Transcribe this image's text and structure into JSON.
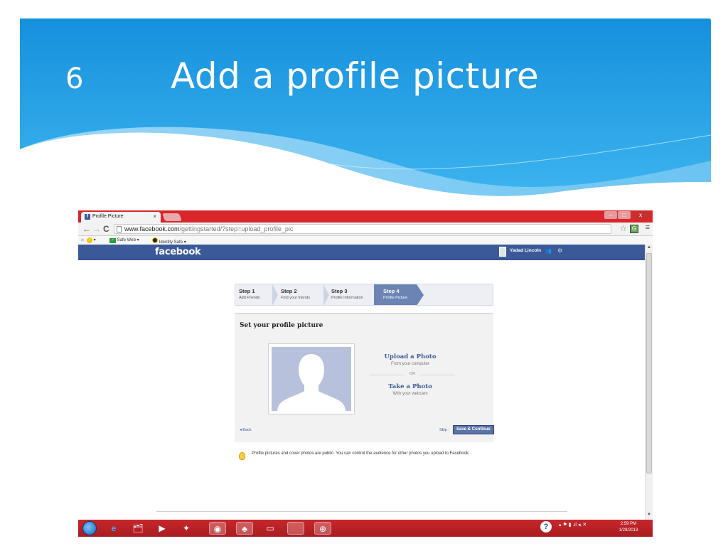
{
  "slide": {
    "number": "6",
    "title": "Add a profile picture"
  },
  "browser": {
    "tab_title": "Profile Picture",
    "tab_close": "×",
    "url_domain": "www.facebook.com",
    "url_path": "/gettingstarted/?step=upload_profile_pic",
    "back": "←",
    "forward": "→",
    "reload": "C",
    "star": "☆",
    "menu": "≡",
    "window_minimize": "–",
    "window_maximize": "□",
    "window_close": "x"
  },
  "toolbar": {
    "close": "✕",
    "check_menu": "✓ ▾",
    "safe_web": "Safe Web ▾",
    "identity_safe": "Identity Safe ▾"
  },
  "facebook": {
    "logo": "facebook",
    "user_name": "Yadad Lincoln",
    "steps": [
      {
        "title": "Step 1",
        "sub": "Add Friends"
      },
      {
        "title": "Step 2",
        "sub": "Find your friends"
      },
      {
        "title": "Step 3",
        "sub": "Profile Information"
      },
      {
        "title": "Step 4",
        "sub": "Profile Picture"
      }
    ],
    "card_title": "Set your profile picture",
    "upload_title": "Upload a Photo",
    "upload_sub": "From your computer",
    "or": "OR",
    "take_title": "Take a Photo",
    "take_sub": "With your webcam",
    "back": "◂ Back",
    "skip": "Skip ·",
    "save": "Save & Continue",
    "notice": "Profile pictures and cover photos are public. You can control the audience for other photos you upload to Facebook."
  },
  "taskbar": {
    "help": "?",
    "tray_icons": "▴  ⚑  ▮  .ıl  ◂ᵢ  ✕",
    "time": "2:59 PM",
    "date": "1/29/2013"
  },
  "colors": {
    "facebook_blue": "#3b5998",
    "slide_blue": "#1b8ad6",
    "window_red": "#d8262a"
  }
}
